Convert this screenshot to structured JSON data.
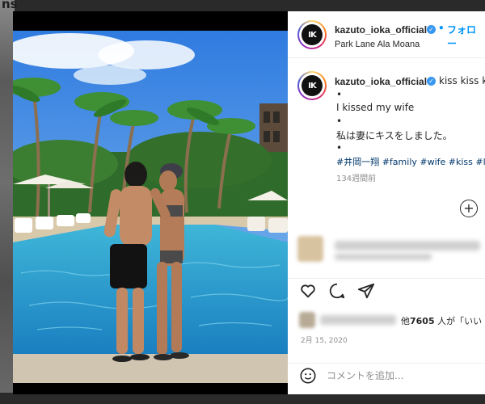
{
  "background": {
    "corner_text": "ns"
  },
  "post": {
    "username": "kazuto_ioka_official",
    "follow_label": "フォロー",
    "separator": "•",
    "location": "Park Lane Ala Moana",
    "avatar_logo": "IK"
  },
  "caption": {
    "username": "kazuto_ioka_official",
    "first_line": "kiss kiss ki",
    "dot1": "•",
    "line2": "I kissed my wife",
    "dot2": "•",
    "line3": "私は妻にキスをしました。",
    "dot3": "•",
    "hashtags": "#井岡一翔 #family #wife #kiss #lo",
    "time_ago": "134週間前"
  },
  "actions": {
    "like_icon": "heart-icon",
    "comment_icon": "comment-icon",
    "share_icon": "share-icon"
  },
  "likes": {
    "prefix": "他",
    "count": "7605",
    "suffix": " 人が「いい"
  },
  "date": "2月 15, 2020",
  "comment_box": {
    "placeholder": "コメントを追加..."
  },
  "colors": {
    "link_blue": "#0095f6",
    "hashtag_blue": "#00376b",
    "verified_blue": "#3897f0",
    "text_dark": "#262626",
    "text_gray": "#8e8e8e"
  }
}
